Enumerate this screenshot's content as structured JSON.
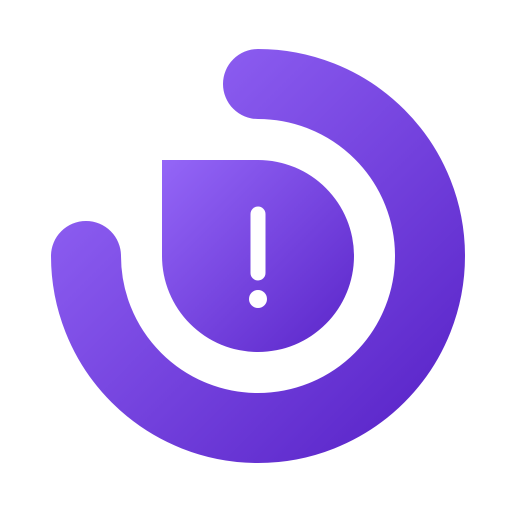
{
  "icon": {
    "name": "app-alert-icon",
    "ring_name": "progress-ring-arc",
    "badge_name": "droplet-badge",
    "symbol_name": "exclamation-mark-icon",
    "symbol_text": "!"
  },
  "colors": {
    "background": "#ffffff",
    "gradient_start": "#9466f7",
    "gradient_end": "#5a25c9",
    "symbol": "#ffffff"
  }
}
